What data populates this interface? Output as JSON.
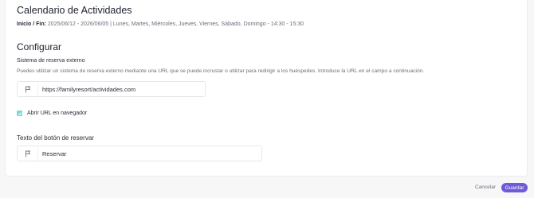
{
  "header": {
    "title": "Calendario de Actividades",
    "dates_label": "Inicio / Fin:",
    "dates_value": "2025/06/12 - 2026/06/05 | Lunes, Martes, Miércoles, Jueves, Viernes, Sábado, Domingo - 14:30 - 15:30"
  },
  "configure": {
    "title": "Configurar",
    "external_label": "Sistema de reserva externo",
    "external_description": "Puedes utilizar un sistema de reserva externo mediante una URL que se puede incrustar o utilizar para redirigir a los huéspedes. Introduce la URL en el campo a continuación.",
    "url_value": "https://familyresort/actividades.com",
    "url_icon": "flag-icon",
    "open_in_browser_label": "Abrir URL en navegador",
    "open_in_browser_checked": true,
    "button_text_label": "Texto del botón de reservar",
    "button_text_value": "Reservar",
    "button_text_icon": "flag-icon"
  },
  "footer": {
    "cancel_label": "Cancelar",
    "save_label": "Guardar"
  },
  "colors": {
    "accent": "#6f5bd8",
    "checkbox": "#7fd5cf"
  }
}
